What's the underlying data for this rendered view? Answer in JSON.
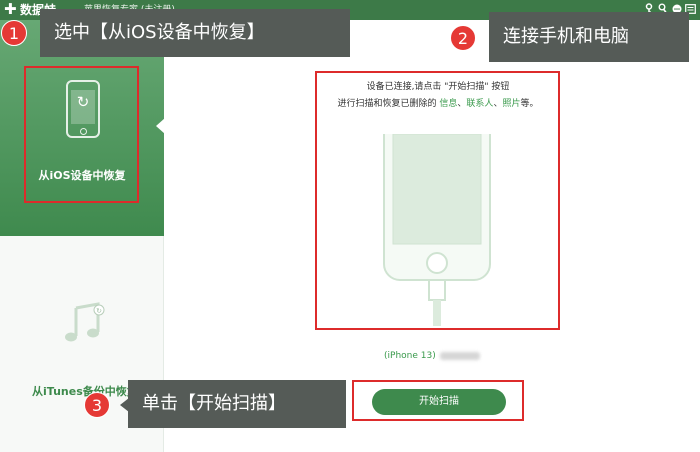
{
  "titlebar": {
    "app_name": "数据蛙",
    "subtitle": "苹果恢复专家 (未注册)",
    "icons": [
      "key-icon",
      "wrench-icon",
      "chat-icon",
      "menu-icon"
    ]
  },
  "sidebar": {
    "items": [
      {
        "label": "从iOS设备中恢复",
        "icon": "phone-refresh-icon",
        "active": true
      },
      {
        "label": "从iTunes备份中恢复",
        "icon": "music-icon",
        "active": false
      }
    ]
  },
  "main": {
    "instruction_line1": "设备已连接,请点击 \"开始扫描\" 按钮",
    "instruction_line2_prefix": "进行扫描和恢复已删除的 ",
    "instruction_line2_links": [
      "信息",
      "联系人",
      "照片"
    ],
    "instruction_line2_sep": "、",
    "instruction_line2_suffix": "等。",
    "device_model": "(iPhone 13)",
    "start_button_label": "开始扫描"
  },
  "tutorial": {
    "steps": [
      {
        "number": "1",
        "text": "选中【从iOS设备中恢复】"
      },
      {
        "number": "2",
        "text": "连接手机和电脑"
      },
      {
        "number": "3",
        "text": "单击【开始扫描】"
      }
    ]
  },
  "colors": {
    "brand_green": "#3e8a4d",
    "highlight_red": "#dd2b2b",
    "callout_bg": "#555b57",
    "badge_red": "#e53935"
  }
}
